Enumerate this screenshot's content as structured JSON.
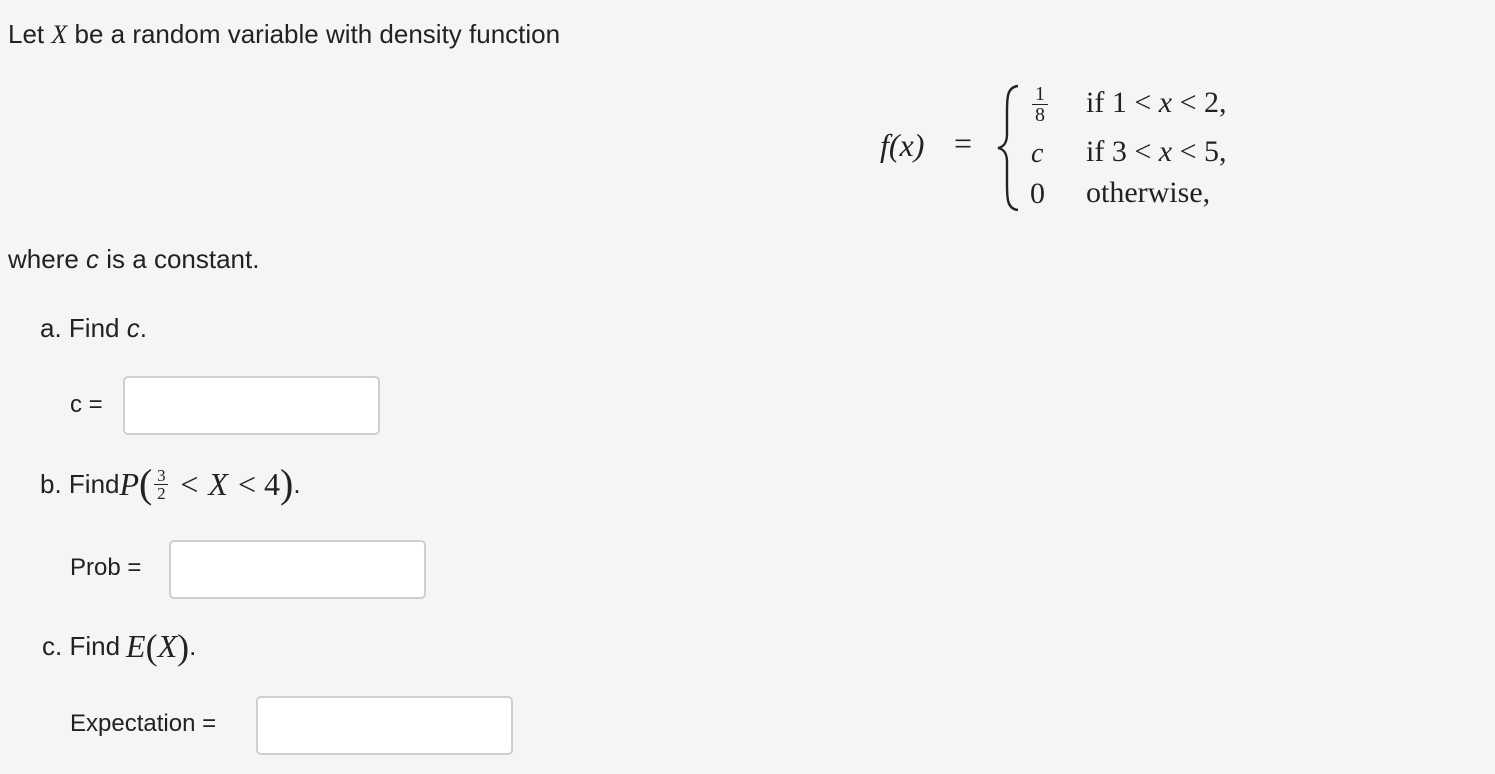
{
  "intro": {
    "pre": "Let ",
    "var": "X",
    "post": " be a random variable with density function"
  },
  "formula": {
    "lhs": "f(x)",
    "eq": "=",
    "frac_num": "1",
    "frac_den": "8",
    "row2_value": "c",
    "row3_value": "0",
    "cond1_if": "if 1 <",
    "cond1_var": "x",
    "cond1_tail": "< 2,",
    "cond2_if": "if 3 <",
    "cond2_var": "x",
    "cond2_tail": "< 5,",
    "cond3": "otherwise,"
  },
  "where": {
    "pre": "where ",
    "var": "c",
    "post": " is a constant."
  },
  "part_a": {
    "prefix": "a. Find ",
    "var": "c",
    "suffix": ".",
    "label": "c =",
    "value": ""
  },
  "part_b": {
    "prefix": "b. Find ",
    "P": "P",
    "frac_num": "3",
    "frac_den": "2",
    "rel1": "<",
    "var": "X",
    "rel2": "< 4",
    "suffix": ".",
    "label": "Prob =",
    "value": ""
  },
  "part_c": {
    "prefix": "c. Find ",
    "E": "E",
    "var": "X",
    "suffix": ".",
    "label": "Expectation =",
    "value": ""
  }
}
